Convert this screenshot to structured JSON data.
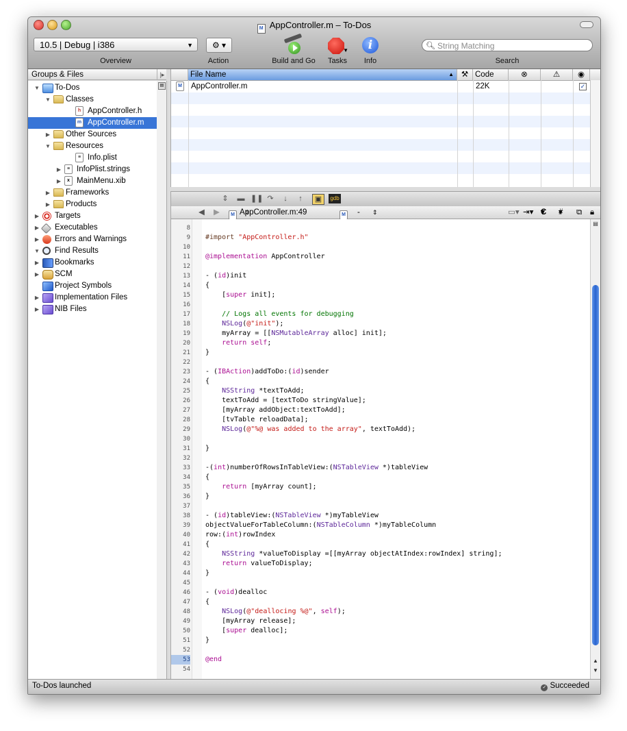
{
  "window": {
    "title": "AppController.m – To-Dos"
  },
  "toolbar": {
    "overview_value": "10.5 | Debug | i386",
    "overview_label": "Overview",
    "action_label": "Action",
    "action_glyph": "⚙ ▾",
    "build_label": "Build and Go",
    "tasks_label": "Tasks",
    "info_label": "Info",
    "info_glyph": "i",
    "search_placeholder": "String Matching",
    "search_label": "Search"
  },
  "sidebar": {
    "header": "Groups & Files",
    "items": [
      {
        "label": "To-Dos",
        "icon": "project-icon",
        "indent": 0,
        "disclosure": "open",
        "selected": false
      },
      {
        "label": "Classes",
        "icon": "folder-icon",
        "indent": 1,
        "disclosure": "open",
        "selected": false
      },
      {
        "label": "AppController.h",
        "icon": "header-file-icon",
        "indent": 3,
        "disclosure": "none",
        "selected": false
      },
      {
        "label": "AppController.m",
        "icon": "source-file-icon",
        "indent": 3,
        "disclosure": "none",
        "selected": true
      },
      {
        "label": "Other Sources",
        "icon": "folder-icon",
        "indent": 1,
        "disclosure": "closed",
        "selected": false
      },
      {
        "label": "Resources",
        "icon": "folder-icon",
        "indent": 1,
        "disclosure": "open",
        "selected": false
      },
      {
        "label": "Info.plist",
        "icon": "plist-file-icon",
        "indent": 3,
        "disclosure": "none",
        "selected": false
      },
      {
        "label": "InfoPlist.strings",
        "icon": "strings-file-icon",
        "indent": 2,
        "disclosure": "closed",
        "selected": false
      },
      {
        "label": "MainMenu.xib",
        "icon": "xib-file-icon",
        "indent": 2,
        "disclosure": "closed",
        "selected": false
      },
      {
        "label": "Frameworks",
        "icon": "folder-icon",
        "indent": 1,
        "disclosure": "closed",
        "selected": false
      },
      {
        "label": "Products",
        "icon": "folder-icon",
        "indent": 1,
        "disclosure": "closed",
        "selected": false
      },
      {
        "label": "Targets",
        "icon": "target-icon",
        "indent": 0,
        "disclosure": "closed",
        "selected": false
      },
      {
        "label": "Executables",
        "icon": "executable-icon",
        "indent": 0,
        "disclosure": "closed",
        "selected": false
      },
      {
        "label": "Errors and Warnings",
        "icon": "warning-icon",
        "indent": 0,
        "disclosure": "closed",
        "selected": false
      },
      {
        "label": "Find Results",
        "icon": "magnifier-icon",
        "indent": 0,
        "disclosure": "open",
        "selected": false
      },
      {
        "label": "Bookmarks",
        "icon": "bookmarks-icon",
        "indent": 0,
        "disclosure": "closed",
        "selected": false
      },
      {
        "label": "SCM",
        "icon": "scm-icon",
        "indent": 0,
        "disclosure": "closed",
        "selected": false
      },
      {
        "label": "Project Symbols",
        "icon": "symbols-cube-icon",
        "indent": 0,
        "disclosure": "none",
        "selected": false
      },
      {
        "label": "Implementation Files",
        "icon": "smart-group-icon",
        "indent": 0,
        "disclosure": "closed",
        "selected": false
      },
      {
        "label": "NIB Files",
        "icon": "smart-group-icon",
        "indent": 0,
        "disclosure": "closed",
        "selected": false
      }
    ]
  },
  "file_list": {
    "columns": [
      "File Name",
      "Code"
    ],
    "rows": [
      {
        "name": "AppController.m",
        "code": "22K",
        "checked": true
      }
    ]
  },
  "editor": {
    "file_popup": "AppController.m:49",
    "symbol_popup": "-dealloc",
    "menu_c": "C",
    "menu_hash": "#",
    "current_line": "53",
    "lines": [
      {
        "n": "8",
        "t": ""
      },
      {
        "n": "9",
        "t": "#import \"AppController.h\"",
        "c": "pp"
      },
      {
        "n": "10",
        "t": ""
      },
      {
        "n": "11",
        "t": "@implementation AppController"
      },
      {
        "n": "12",
        "t": ""
      },
      {
        "n": "13",
        "t": "- (id)init"
      },
      {
        "n": "14",
        "t": "{"
      },
      {
        "n": "15",
        "t": "    [super init];"
      },
      {
        "n": "16",
        "t": ""
      },
      {
        "n": "17",
        "t": "    // Logs all events for debugging",
        "c": "cm"
      },
      {
        "n": "18",
        "t": "    NSLog(@\"init\");"
      },
      {
        "n": "19",
        "t": "    myArray = [[NSMutableArray alloc] init];"
      },
      {
        "n": "20",
        "t": "    return self;"
      },
      {
        "n": "21",
        "t": "}"
      },
      {
        "n": "22",
        "t": ""
      },
      {
        "n": "23",
        "t": "- (IBAction)addToDo:(id)sender"
      },
      {
        "n": "24",
        "t": "{"
      },
      {
        "n": "25",
        "t": "    NSString *textToAdd;"
      },
      {
        "n": "26",
        "t": "    textToAdd = [textToDo stringValue];"
      },
      {
        "n": "27",
        "t": "    [myArray addObject:textToAdd];"
      },
      {
        "n": "28",
        "t": "    [tvTable reloadData];"
      },
      {
        "n": "29",
        "t": "    NSLog(@\"%@ was added to the array\", textToAdd);"
      },
      {
        "n": "30",
        "t": ""
      },
      {
        "n": "31",
        "t": "}"
      },
      {
        "n": "32",
        "t": ""
      },
      {
        "n": "33",
        "t": "-(int)numberOfRowsInTableView:(NSTableView *)tableView"
      },
      {
        "n": "34",
        "t": "{"
      },
      {
        "n": "35",
        "t": "    return [myArray count];"
      },
      {
        "n": "36",
        "t": "}"
      },
      {
        "n": "37",
        "t": ""
      },
      {
        "n": "38",
        "t": "- (id)tableView:(NSTableView *)myTableView"
      },
      {
        "n": "39",
        "t": "objectValueForTableColumn:(NSTableColumn *)myTableColumn"
      },
      {
        "n": "40",
        "t": "row:(int)rowIndex"
      },
      {
        "n": "41",
        "t": "{"
      },
      {
        "n": "42",
        "t": "    NSString *valueToDisplay =[[myArray objectAtIndex:rowIndex] string];"
      },
      {
        "n": "43",
        "t": "    return valueToDisplay;"
      },
      {
        "n": "44",
        "t": "}"
      },
      {
        "n": "45",
        "t": ""
      },
      {
        "n": "46",
        "t": "- (void)dealloc"
      },
      {
        "n": "47",
        "t": "{"
      },
      {
        "n": "48",
        "t": "    NSLog(@\"deallocing %@\", self);"
      },
      {
        "n": "49",
        "t": "    [myArray release];"
      },
      {
        "n": "50",
        "t": "    [super dealloc];"
      },
      {
        "n": "51",
        "t": "}"
      },
      {
        "n": "52",
        "t": ""
      },
      {
        "n": "53",
        "t": "@end"
      },
      {
        "n": "54",
        "t": ""
      }
    ]
  },
  "status": {
    "left": "To-Dos launched",
    "right": "Succeeded"
  },
  "colors": {
    "selection": "#3875d7",
    "keyword": "#aa0d91",
    "comment": "#007400",
    "string": "#c41a16",
    "class_name": "#5c2699"
  }
}
